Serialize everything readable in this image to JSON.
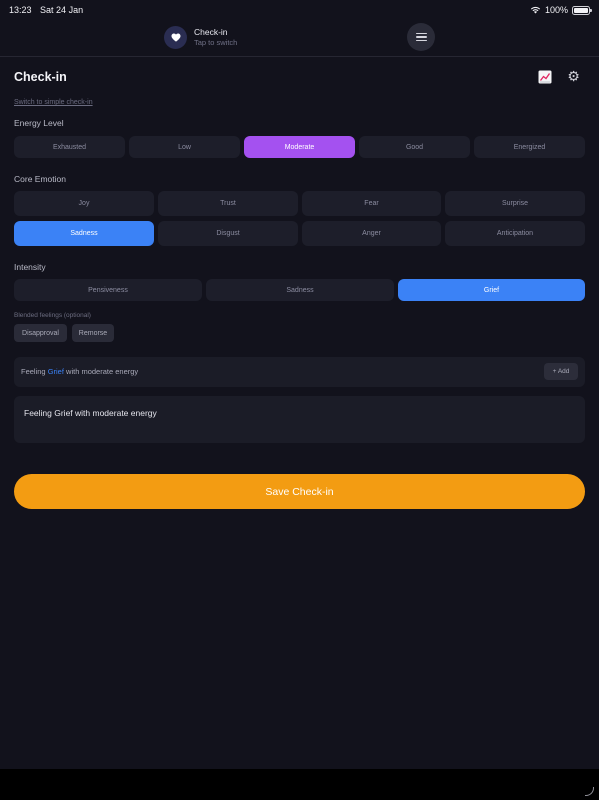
{
  "status": {
    "time": "13:23",
    "date": "Sat 24 Jan",
    "battery": "100%",
    "battery_level": 1.0
  },
  "header": {
    "mode_title": "Check-in",
    "mode_subtitle": "Tap to switch"
  },
  "page": {
    "title": "Check-in",
    "simple_link": "Switch to simple check-in"
  },
  "energy": {
    "label": "Energy Level",
    "options": [
      "Exhausted",
      "Low",
      "Moderate",
      "Good",
      "Energized"
    ],
    "selected": "Moderate"
  },
  "emotion": {
    "label": "Core Emotion",
    "options": [
      "Joy",
      "Trust",
      "Fear",
      "Surprise",
      "Sadness",
      "Disgust",
      "Anger",
      "Anticipation"
    ],
    "selected": "Sadness"
  },
  "intensity": {
    "label": "Intensity",
    "options": [
      "Pensiveness",
      "Sadness",
      "Grief"
    ],
    "selected": "Grief"
  },
  "blended": {
    "label": "Blended feelings (optional)",
    "chips": [
      "Disapproval",
      "Remorse"
    ]
  },
  "summary": {
    "prefix": "Feeling ",
    "emotion": "Grief",
    "suffix": " with moderate energy",
    "add_label": "+ Add"
  },
  "note": {
    "value": "Feeling Grief with moderate energy"
  },
  "save_label": "Save Check-in",
  "colors": {
    "background": "#12121c",
    "energy_selected": "#a451f0",
    "emotion_selected": "#3b82f6",
    "save": "#f39c12"
  },
  "icons": {
    "heart": "heart-icon",
    "menu": "hamburger-menu-icon",
    "chart": "chart-icon",
    "settings": "gear-icon",
    "wifi": "wifi-icon",
    "battery": "battery-icon"
  }
}
